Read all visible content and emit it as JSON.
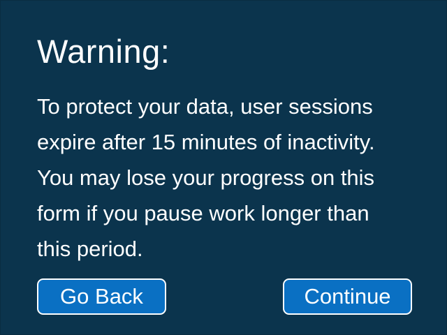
{
  "dialog": {
    "title": "Warning:",
    "message_lines": [
      "To protect your data, user sessions",
      "expire after 15 minutes of inactivity.",
      "You may lose your progress on this",
      "form if you pause work longer than",
      "this period."
    ],
    "buttons": {
      "back_label": "Go Back",
      "continue_label": "Continue"
    }
  },
  "colors": {
    "background": "#0b344d",
    "button": "#0a70c3",
    "text": "#ffffff"
  }
}
